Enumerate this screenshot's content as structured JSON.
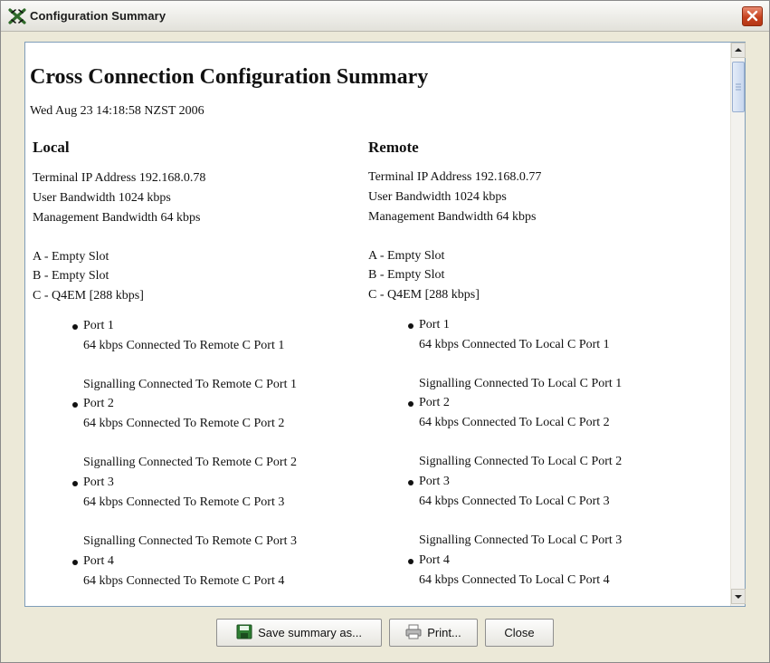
{
  "window": {
    "title": "Configuration Summary",
    "app_icon": "x-tools-icon",
    "close_icon": "close-icon"
  },
  "summary": {
    "title": "Cross Connection Configuration Summary",
    "date": "Wed Aug 23 14:18:58 NZST 2006",
    "local": {
      "heading": "Local",
      "ip": "Terminal IP Address 192.168.0.78",
      "user_bw": "User Bandwidth 1024 kbps",
      "mgmt_bw": "Management Bandwidth 64 kbps",
      "slots": [
        "A - Empty Slot",
        "B - Empty Slot",
        "C - Q4EM [288 kbps]"
      ],
      "ports": [
        {
          "name": "Port 1",
          "data": "64 kbps Connected To Remote C Port 1",
          "signalling": "Signalling Connected To Remote C Port 1"
        },
        {
          "name": "Port 2",
          "data": "64 kbps Connected To Remote C Port 2",
          "signalling": "Signalling Connected To Remote C Port 2"
        },
        {
          "name": "Port 3",
          "data": "64 kbps Connected To Remote C Port 3",
          "signalling": "Signalling Connected To Remote C Port 3"
        },
        {
          "name": "Port 4",
          "data": "64 kbps Connected To Remote C Port 4",
          "signalling": ""
        }
      ]
    },
    "remote": {
      "heading": "Remote",
      "ip": "Terminal IP Address 192.168.0.77",
      "user_bw": "User Bandwidth 1024 kbps",
      "mgmt_bw": "Management Bandwidth 64 kbps",
      "slots": [
        "A - Empty Slot",
        "B - Empty Slot",
        "C - Q4EM [288 kbps]"
      ],
      "ports": [
        {
          "name": "Port 1",
          "data": "64 kbps Connected To Local C Port 1",
          "signalling": "Signalling Connected To Local C Port 1"
        },
        {
          "name": "Port 2",
          "data": "64 kbps Connected To Local C Port 2",
          "signalling": "Signalling Connected To Local C Port 2"
        },
        {
          "name": "Port 3",
          "data": "64 kbps Connected To Local C Port 3",
          "signalling": "Signalling Connected To Local C Port 3"
        },
        {
          "name": "Port 4",
          "data": "64 kbps Connected To Local C Port 4",
          "signalling": ""
        }
      ]
    }
  },
  "buttons": {
    "save_label": "Save summary as...",
    "save_icon": "floppy-disk-icon",
    "print_label": "Print...",
    "print_icon": "printer-icon",
    "close_label": "Close"
  },
  "colors": {
    "titlebar_close": "#c6421f",
    "content_border": "#7f9db9",
    "dialog_bg": "#ece9d8"
  }
}
